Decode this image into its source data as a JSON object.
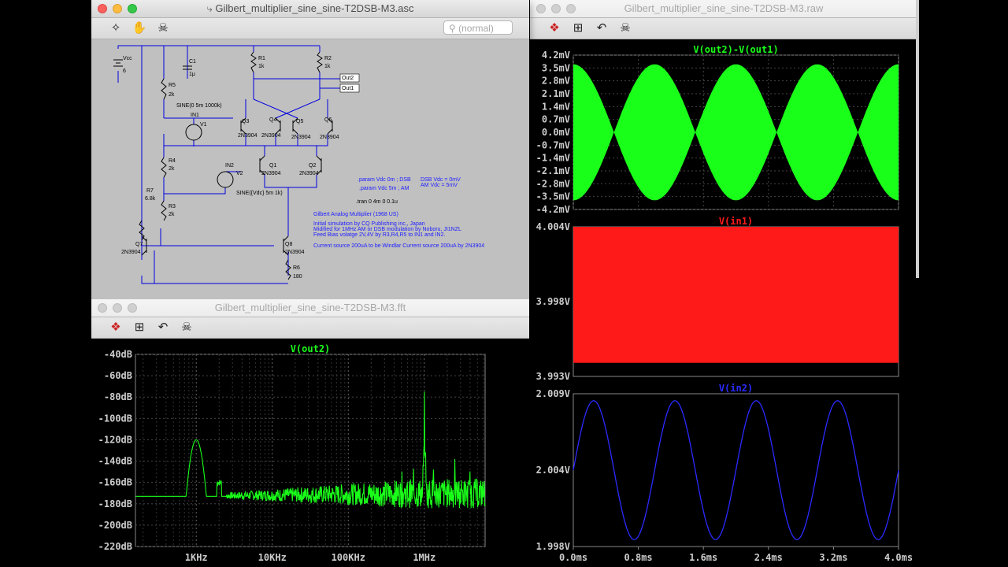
{
  "schematic_window": {
    "title": "Gilbert_multiplier_sine_sine-T2DSB-M3.asc",
    "search_placeholder": "(normal)",
    "toolbar_icons": [
      "run-icon",
      "pan-hand-icon",
      "probe-icon"
    ],
    "components": {
      "vcc_label": "Vcc",
      "vcc_value": "6",
      "c1_label": "C1",
      "c1_value": "1μ",
      "r1_label": "R1",
      "r1_value": "1k",
      "r2_label": "R2",
      "r2_value": "1k",
      "r5_label": "R5",
      "r5_value": "2k",
      "r4_label": "R4",
      "r4_value": "2k",
      "r3_label": "R3",
      "r3_value": "2k",
      "r7_label": "R7",
      "r7_value": "6.8k",
      "r6_label": "R6",
      "r6_value": "180",
      "out2_label": "Out2",
      "out1_label": "Out1",
      "in1_label": "IN1",
      "in2_label": "IN2",
      "v1_label": "V1",
      "v2_label": "V2",
      "v1_value": "SINE(0 5m 1000k)",
      "v2_value": "SINE({Vdc} 5m 1k)",
      "q3": "Q3",
      "q4": "Q4",
      "q5": "Q5",
      "q6": "Q6",
      "q1": "Q1",
      "q2": "Q2",
      "q7": "Q7",
      "q8": "Q8",
      "part": "2N3904"
    },
    "directives": {
      "param_dsb": ".param Vdc 0m ; DSB",
      "param_am": ".param Vdc 5m ; AM",
      "dsb_note": "DSB Vdc = 0mV",
      "am_note": "AM  Vdc = 5mV",
      "tran": ".tran 0 4m 0 0.1u"
    },
    "comments": [
      "Gilbert Analog Multiplier (1968 US)",
      "Initial simulation by CQ Publishing inc., Japan",
      "Midified for 1MHz AM or DSB modulation by Noboru, JI1NZL",
      "Feed Bias volatge 2V,4V by R3,R4,R5 to IN1 and IN2.",
      "Current source 200uA to be Windlar Current source 200uA by 2N3904"
    ]
  },
  "fft_window": {
    "title": "Gilbert_multiplier_sine_sine-T2DSB-M3.fft",
    "toolbar_icons": [
      "autorange-icon",
      "zoom-fit-icon",
      "undo-zoom-icon",
      "probe-icon"
    ],
    "plot_title": "V(out2)",
    "y_ticks": [
      "-40dB",
      "-60dB",
      "-80dB",
      "-100dB",
      "-120dB",
      "-140dB",
      "-160dB",
      "-180dB",
      "-200dB",
      "-220dB"
    ],
    "x_ticks": [
      "1KHz",
      "10KHz",
      "100KHz",
      "1MHz"
    ]
  },
  "raw_window": {
    "title": "Gilbert_multiplier_sine_sine-T2DSB-M3.raw",
    "toolbar_icons": [
      "autorange-icon",
      "zoom-fit-icon",
      "undo-zoom-icon",
      "probe-icon"
    ],
    "pane1_title": "V(out2)-V(out1)",
    "pane1_ticks": [
      "4.2mV",
      "3.5mV",
      "2.8mV",
      "2.1mV",
      "1.4mV",
      "0.7mV",
      "0.0mV",
      "-0.7mV",
      "-1.4mV",
      "-2.1mV",
      "-2.8mV",
      "-3.5mV",
      "-4.2mV"
    ],
    "pane2_title": "V(in1)",
    "pane2_ticks": [
      "4.004V",
      "3.998V",
      "3.993V"
    ],
    "pane3_title": "V(in2)",
    "pane3_ticks": [
      "2.009V",
      "2.004V",
      "1.998V"
    ],
    "x_ticks": [
      "0.0ms",
      "0.8ms",
      "1.6ms",
      "2.4ms",
      "3.2ms",
      "4.0ms"
    ]
  },
  "colors": {
    "trace_green": "#1aff1a",
    "trace_red": "#ff1a1a",
    "trace_blue": "#2a2aff",
    "schematic_bg": "#c0c0c0",
    "wire_blue": "#0000e0"
  },
  "chart_data": [
    {
      "type": "line",
      "title": "V(out2)",
      "x_scale": "log",
      "xlabel": "",
      "ylabel": "",
      "ylim": [
        -220,
        -40
      ],
      "x_tick_labels": [
        "1KHz",
        "10KHz",
        "100KHz",
        "1MHz"
      ],
      "notable_points_hz_db": [
        [
          1000,
          -120
        ],
        [
          2000,
          -160
        ],
        [
          1000000,
          -75
        ],
        [
          1001000,
          -130
        ],
        [
          999000,
          -130
        ]
      ],
      "noise_floor_db": -175,
      "grid": true
    },
    {
      "type": "area",
      "title": "V(out2)-V(out1)",
      "xlim_ms": [
        0,
        4.0
      ],
      "ylim_mV": [
        -4.2,
        4.2
      ],
      "description_values": {
        "envelope_peak_mV": 3.7,
        "envelope_period_ms": 1.0,
        "envelope_zero_ms": [
          0.5,
          1.5,
          2.5,
          3.5
        ]
      },
      "grid": true
    },
    {
      "type": "area",
      "title": "V(in1)",
      "xlim_ms": [
        0,
        4.0
      ],
      "ylim_V": [
        3.993,
        4.004
      ],
      "band_V": [
        3.994,
        4.004
      ],
      "grid": true
    },
    {
      "type": "line",
      "title": "V(in2)",
      "xlim_ms": [
        0,
        4.0
      ],
      "ylim_V": [
        1.998,
        2.009
      ],
      "offset_V": 2.0035,
      "amplitude_V": 0.005,
      "frequency_kHz": 1,
      "grid": true
    }
  ]
}
